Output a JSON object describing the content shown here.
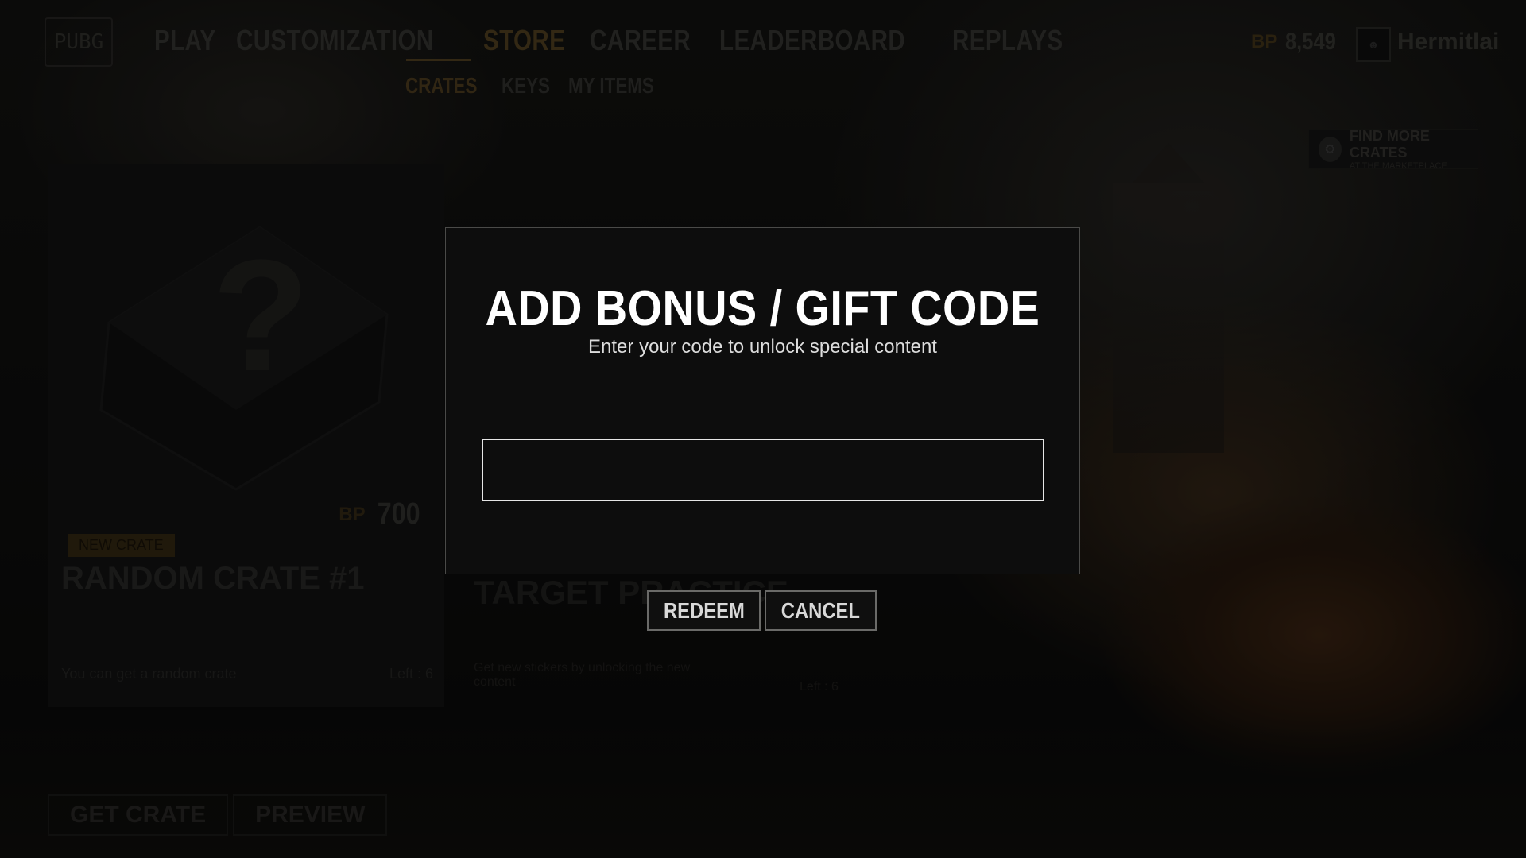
{
  "nav": {
    "logo_text": "PUBG",
    "main_items": [
      {
        "label": "PLAY"
      },
      {
        "label": "CUSTOMIZATION"
      },
      {
        "label": "STORE"
      },
      {
        "label": "CAREER"
      },
      {
        "label": "LEADERBOARD"
      },
      {
        "label": "REPLAYS"
      }
    ],
    "active_main": "STORE",
    "sub_items": [
      {
        "label": "CRATES"
      },
      {
        "label": "KEYS"
      },
      {
        "label": "MY ITEMS"
      }
    ],
    "active_sub": "CRATES"
  },
  "account": {
    "currency_icon": "BP",
    "currency_amount": "8,549",
    "username": "Hermitlai"
  },
  "marketplace": {
    "title": "FIND MORE CRATES",
    "subtitle": "AT THE MARKETPLACE"
  },
  "crate": {
    "price_icon": "BP",
    "price": "700",
    "badge": "NEW CRATE",
    "name": "RANDOM CRATE #1",
    "description": "You can get a random crate",
    "left_text": "Left : 6"
  },
  "target": {
    "title": "TARGET PRACTICE",
    "description": "Get new stickers by unlocking the new content",
    "left_text": "Left : 6"
  },
  "bottom_buttons": {
    "get_crate": "GET CRATE",
    "preview": "PREVIEW"
  },
  "modal": {
    "title": "ADD BONUS / GIFT CODE",
    "subtitle": "Enter your code to unlock special content",
    "input_value": "",
    "redeem_label": "REDEEM",
    "cancel_label": "CANCEL"
  },
  "colors": {
    "accent": "#c98a1e",
    "modal_bg": "#0d0d0d",
    "modal_border": "#4a4a48",
    "text_primary": "#ffffff"
  }
}
